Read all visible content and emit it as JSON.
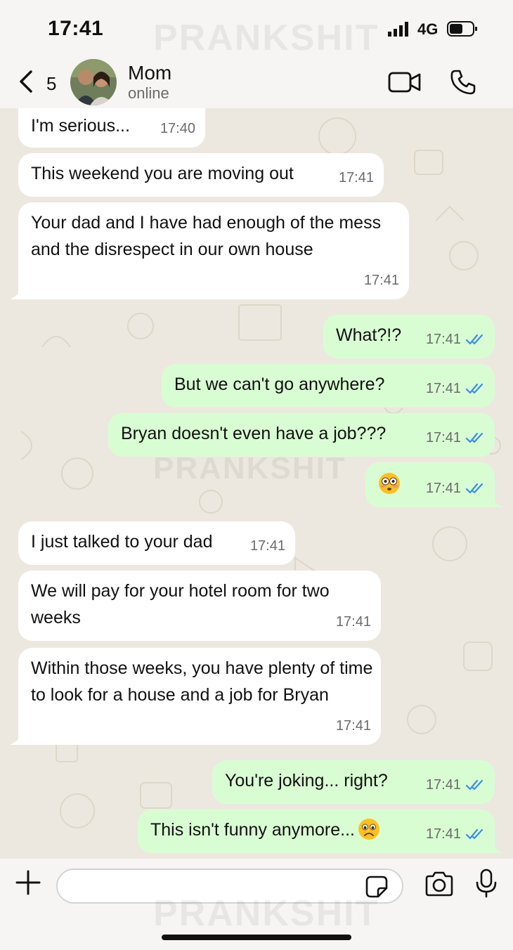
{
  "status_bar": {
    "time": "17:41",
    "network": "4G"
  },
  "watermark": "PRANKSHIT",
  "header": {
    "back_count": "5",
    "contact_name": "Mom",
    "contact_status": "online"
  },
  "messages": [
    {
      "dir": "in",
      "text": "I'm serious...",
      "time": "17:40"
    },
    {
      "dir": "in",
      "text": "This weekend you are moving out",
      "time": "17:41"
    },
    {
      "dir": "in",
      "text": "Your dad and I have had enough of the mess and the disrespect in our own house",
      "time": "17:41"
    },
    {
      "dir": "out",
      "text": "What?!?",
      "time": "17:41",
      "status": "read"
    },
    {
      "dir": "out",
      "text": "But we can't go anywhere?",
      "time": "17:41",
      "status": "read"
    },
    {
      "dir": "out",
      "text": "Bryan doesn't even have a job???",
      "time": "17:41",
      "status": "read"
    },
    {
      "dir": "out",
      "text": "",
      "emoji": "flushed-face",
      "time": "17:41",
      "status": "read"
    },
    {
      "dir": "in",
      "text": "I just talked to your dad",
      "time": "17:41"
    },
    {
      "dir": "in",
      "text": "We will pay for your hotel room for two weeks",
      "time": "17:41"
    },
    {
      "dir": "in",
      "text": "Within those weeks, you have plenty of time to look for a house and a job for Bryan",
      "time": "17:41"
    },
    {
      "dir": "out",
      "text": "You're joking... right?",
      "time": "17:41",
      "status": "read"
    },
    {
      "dir": "out",
      "text": "This isn't funny anymore...",
      "emoji": "worried-face",
      "time": "17:41",
      "status": "read"
    }
  ],
  "input": {
    "placeholder": ""
  },
  "colors": {
    "incoming": "#ffffff",
    "outgoing": "#d9fdd3",
    "read_tick": "#3b8de8",
    "chat_bg": "#ede8df"
  },
  "icons": [
    "chevron-left-icon",
    "video-camera-icon",
    "phone-icon",
    "plus-icon",
    "sticker-icon",
    "camera-icon",
    "microphone-icon",
    "double-check-icon"
  ]
}
